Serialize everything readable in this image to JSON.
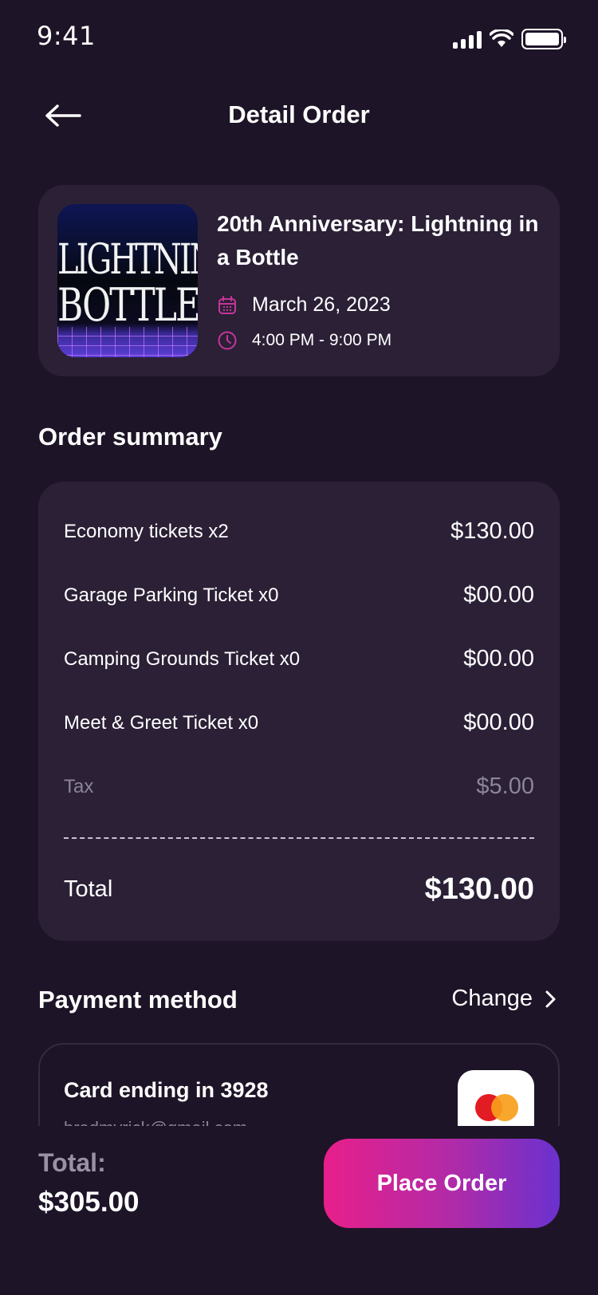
{
  "status_bar": {
    "time": "9:41"
  },
  "header": {
    "title": "Detail Order"
  },
  "event": {
    "title": "20th Anniversary: Lightning in a Bottle",
    "date": "March 26, 2023",
    "time": "4:00 PM - 9:00 PM",
    "image_text_line1": "LIGHTNING",
    "image_text_line2": "BOTTLE"
  },
  "order_summary": {
    "title": "Order summary",
    "items": [
      {
        "label": "Economy tickets x2",
        "amount": "$130.00"
      },
      {
        "label": "Garage Parking Ticket x0",
        "amount": "$00.00"
      },
      {
        "label": "Camping Grounds Ticket x0",
        "amount": "$00.00"
      },
      {
        "label": "Meet & Greet Ticket x0",
        "amount": "$00.00"
      }
    ],
    "tax": {
      "label": "Tax",
      "amount": "$5.00"
    },
    "total": {
      "label": "Total",
      "amount": "$130.00"
    }
  },
  "payment": {
    "title": "Payment method",
    "change_label": "Change",
    "card_label": "Card ending in 3928",
    "card_email": "bradmyrick@gmail.com"
  },
  "footer": {
    "total_label": "Total:",
    "total_value": "$305.00",
    "place_order_label": "Place Order"
  },
  "colors": {
    "background": "#1e1427",
    "card": "#2b2036",
    "accent_pink": "#e81f8a",
    "accent_purple": "#6a31cf",
    "icon_accent": "#c6359a"
  }
}
